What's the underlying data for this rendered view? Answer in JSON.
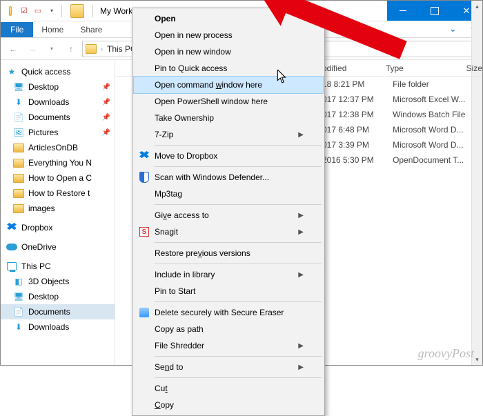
{
  "window": {
    "title": "My Work"
  },
  "tabs": {
    "file": "File",
    "home": "Home",
    "share": "Share"
  },
  "breadcrumb": {
    "root": "This PC"
  },
  "sidebar": {
    "quick": {
      "label": "Quick access"
    },
    "quick_items": [
      {
        "label": "Desktop",
        "pinned": true
      },
      {
        "label": "Downloads",
        "pinned": true
      },
      {
        "label": "Documents",
        "pinned": true
      },
      {
        "label": "Pictures",
        "pinned": true
      },
      {
        "label": "ArticlesOnDB"
      },
      {
        "label": "Everything You N"
      },
      {
        "label": "How to Open a C"
      },
      {
        "label": "How to Restore t"
      },
      {
        "label": "images"
      }
    ],
    "dropbox": "Dropbox",
    "onedrive": "OneDrive",
    "thispc": "This PC",
    "pc_items": [
      {
        "label": "3D Objects"
      },
      {
        "label": "Desktop"
      },
      {
        "label": "Documents",
        "selected": true
      },
      {
        "label": "Downloads"
      }
    ]
  },
  "columns": {
    "date": "odified",
    "type": "Type",
    "size": "Size"
  },
  "files": [
    {
      "date": "18 8:21 PM",
      "type": "File folder"
    },
    {
      "date": "017 12:37 PM",
      "type": "Microsoft Excel W..."
    },
    {
      "date": "017 12:38 PM",
      "type": "Windows Batch File"
    },
    {
      "date": "017 6:48 PM",
      "type": "Microsoft Word D..."
    },
    {
      "date": "017 3:39 PM",
      "type": "Microsoft Word D..."
    },
    {
      "date": "2016 5:30 PM",
      "type": "OpenDocument T..."
    }
  ],
  "ctx": {
    "open": "Open",
    "open_proc": "Open in new process",
    "open_win": "Open in new window",
    "pin": "Pin to Quick access",
    "cmd_pre": "Open command ",
    "cmd_u": "w",
    "cmd_post": "indow here",
    "ps": "Open PowerShell window here",
    "take": "Take Ownership",
    "7zip": "7-Zip",
    "dropbox": "Move to Dropbox",
    "defender": "Scan with Windows Defender...",
    "mp3tag": "Mp3tag",
    "give_pre": "Gi",
    "give_u": "v",
    "give_post": "e access to",
    "snagit": "Snagit",
    "restore_pre": "Restore pre",
    "restore_u": "v",
    "restore_post": "ious versions",
    "include": "Include in library",
    "pinstart": "Pin to Start",
    "secure": "Delete securely with Secure Eraser",
    "copypath": "Copy as path",
    "shredder": "File Shredder",
    "sendto_pre": "Se",
    "sendto_u": "n",
    "sendto_post": "d to",
    "cut_pre": "Cu",
    "cut_u": "t",
    "copy_pre": "",
    "copy_u": "C",
    "copy_post": "opy"
  },
  "watermark": "groovyPost"
}
